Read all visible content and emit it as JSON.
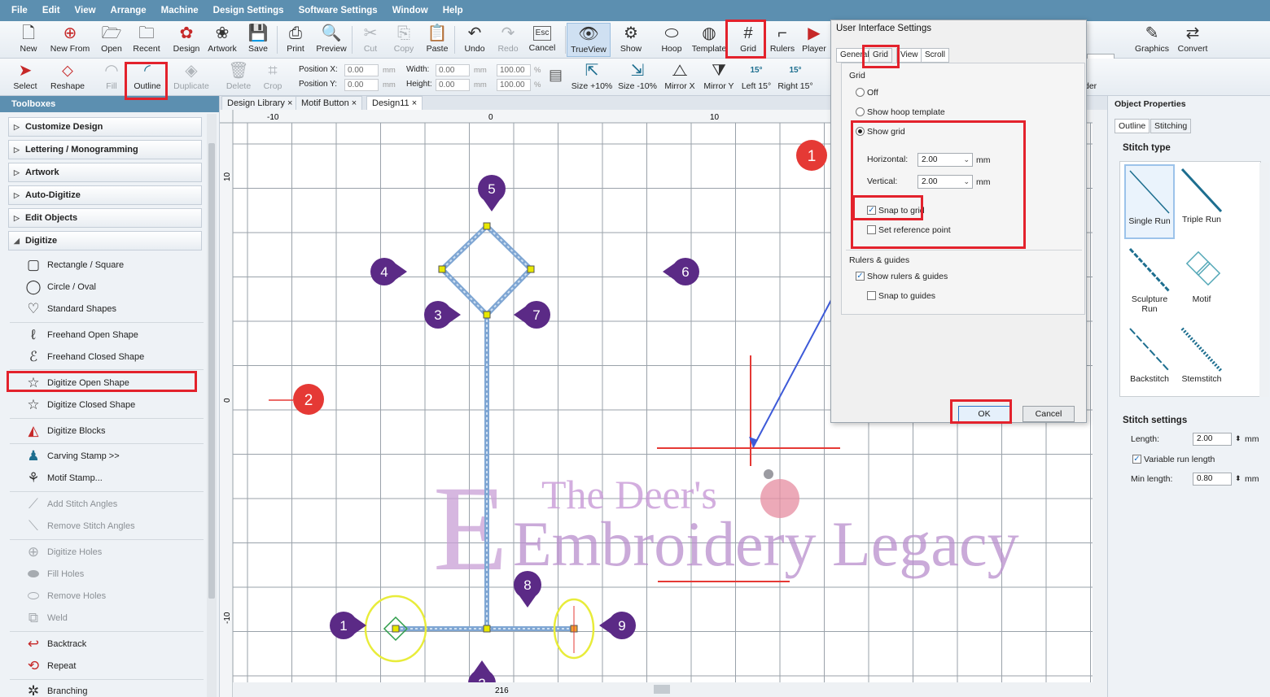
{
  "menu": [
    "File",
    "Edit",
    "View",
    "Arrange",
    "Machine",
    "Design Settings",
    "Software Settings",
    "Window",
    "Help"
  ],
  "toolbar1": [
    {
      "label": "New",
      "icon": "new-file-icon"
    },
    {
      "label": "New From",
      "icon": "new-from-icon"
    },
    {
      "label": "Open",
      "icon": "folder-open-icon"
    },
    {
      "label": "Recent",
      "icon": "recent-folder-icon"
    },
    {
      "label": "Design",
      "icon": "design-icon"
    },
    {
      "label": "Artwork",
      "icon": "artwork-icon"
    },
    {
      "label": "Save",
      "icon": "save-icon"
    },
    {
      "label": "Print",
      "icon": "print-icon"
    },
    {
      "label": "Preview",
      "icon": "preview-icon"
    },
    {
      "label": "Cut",
      "icon": "cut-icon"
    },
    {
      "label": "Copy",
      "icon": "copy-icon"
    },
    {
      "label": "Paste",
      "icon": "paste-icon"
    },
    {
      "label": "Undo",
      "icon": "undo-icon"
    },
    {
      "label": "Redo",
      "icon": "redo-icon"
    },
    {
      "label": "Cancel",
      "icon": "esc-icon",
      "glyph": "Esc"
    },
    {
      "label": "TrueView",
      "icon": "trueview-icon"
    },
    {
      "label": "Show",
      "icon": "show-icon"
    },
    {
      "label": "Hoop",
      "icon": "hoop-icon"
    },
    {
      "label": "Template",
      "icon": "template-icon"
    },
    {
      "label": "Grid",
      "icon": "grid-icon"
    },
    {
      "label": "Rulers",
      "icon": "rulers-icon"
    },
    {
      "label": "Player",
      "icon": "player-icon"
    },
    {
      "label": "Graphics",
      "icon": "graphics-icon"
    },
    {
      "label": "Convert",
      "icon": "convert-icon"
    }
  ],
  "toolbar2": [
    {
      "label": "Select",
      "icon": "select-arrow-icon"
    },
    {
      "label": "Reshape",
      "icon": "reshape-icon"
    },
    {
      "label": "Fill",
      "icon": "fill-icon"
    },
    {
      "label": "Outline",
      "icon": "outline-icon"
    },
    {
      "label": "Duplicate",
      "icon": "duplicate-icon"
    },
    {
      "label": "Delete",
      "icon": "delete-icon"
    },
    {
      "label": "Crop",
      "icon": "crop-icon"
    },
    {
      "label": "Size +10%",
      "icon": "size-plus-icon"
    },
    {
      "label": "Size -10%",
      "icon": "size-minus-icon"
    },
    {
      "label": "Mirror X",
      "icon": "mirror-x-icon"
    },
    {
      "label": "Mirror Y",
      "icon": "mirror-y-icon"
    },
    {
      "label": "Left 15°",
      "icon": "rotate-left-icon"
    },
    {
      "label": "Right 15°",
      "icon": "rotate-right-icon"
    }
  ],
  "position": {
    "pos_x_label": "Position X:",
    "pos_x": "0.00",
    "pos_y_label": "Position Y:",
    "pos_y": "0.00",
    "width_label": "Width:",
    "width": "0.00",
    "height_label": "Height:",
    "height": "0.00",
    "scale_w": "100.00",
    "scale_h": "100.00",
    "unit_mm": "mm",
    "unit_pct": "%",
    "rot15": "15°"
  },
  "toolbox": {
    "title": "Toolboxes",
    "categories": [
      "Customize Design",
      "Lettering / Monogramming",
      "Artwork",
      "Auto-Digitize",
      "Edit Objects",
      "Digitize"
    ],
    "tools": [
      {
        "label": "Rectangle / Square",
        "icon": "rectangle-icon"
      },
      {
        "label": "Circle / Oval",
        "icon": "circle-icon"
      },
      {
        "label": "Standard Shapes",
        "icon": "standard-shapes-icon"
      },
      {
        "label": "Freehand Open Shape",
        "icon": "freehand-open-icon"
      },
      {
        "label": "Freehand Closed Shape",
        "icon": "freehand-closed-icon"
      },
      {
        "label": "Digitize Open Shape",
        "icon": "digitize-open-icon"
      },
      {
        "label": "Digitize Closed Shape",
        "icon": "digitize-closed-icon"
      },
      {
        "label": "Digitize Blocks",
        "icon": "digitize-blocks-icon"
      },
      {
        "label": "Carving Stamp >>",
        "icon": "carving-stamp-icon"
      },
      {
        "label": "Motif Stamp...",
        "icon": "motif-stamp-icon"
      },
      {
        "label": "Add Stitch Angles",
        "icon": "add-angles-icon"
      },
      {
        "label": "Remove Stitch Angles",
        "icon": "remove-angles-icon"
      },
      {
        "label": "Digitize Holes",
        "icon": "digitize-holes-icon"
      },
      {
        "label": "Fill Holes",
        "icon": "fill-holes-icon"
      },
      {
        "label": "Remove Holes",
        "icon": "remove-holes-icon"
      },
      {
        "label": "Weld",
        "icon": "weld-icon"
      },
      {
        "label": "Backtrack",
        "icon": "backtrack-icon"
      },
      {
        "label": "Repeat",
        "icon": "repeat-icon"
      },
      {
        "label": "Branching",
        "icon": "branching-icon"
      }
    ]
  },
  "doc_tabs": [
    "Design Library ×",
    "Motif Button ×",
    "Design11 ×"
  ],
  "ruler": {
    "minus10": "-10",
    "zero": "0",
    "plus10": "10",
    "v10": "10",
    "v0": "0",
    "vminus10": "-10"
  },
  "markers": [
    "1",
    "2",
    "3",
    "4",
    "5",
    "6",
    "7",
    "8",
    "9"
  ],
  "callouts": [
    "1",
    "2"
  ],
  "watermark": {
    "line1": "The Deer's",
    "line2": "Embroidery Legacy"
  },
  "canvas_status": "216",
  "dialog": {
    "title": "User Interface Settings",
    "tabs": [
      "General",
      "Grid",
      "View",
      "Scroll"
    ],
    "grid_group": "Grid",
    "off": "Off",
    "show_hoop_template": "Show hoop template",
    "show_grid": "Show grid",
    "horizontal_label": "Horizontal:",
    "horizontal": "2.00",
    "vertical_label": "Vertical:",
    "vertical": "2.00",
    "unit": "mm",
    "snap_to_grid": "Snap to grid",
    "set_reference_point": "Set reference point",
    "rulers_group": "Rulers & guides",
    "show_rulers": "Show rulers & guides",
    "snap_to_guides": "Snap to guides",
    "ok": "OK",
    "cancel": "Cancel"
  },
  "props": {
    "title": "Object Properties",
    "tabs": [
      "Outline",
      "Stitching"
    ],
    "stitch_type": "Stitch type",
    "types": [
      "Single Run",
      "Triple Run",
      "Sculpture Run",
      "Motif",
      "Backstitch",
      "Stemstitch"
    ],
    "stitch_settings": "Stitch settings",
    "length_label": "Length:",
    "length": "2.00",
    "variable_run": "Variable run length",
    "min_length_label": "Min length:",
    "min_length": "0.80",
    "unit": "mm",
    "partial_label": "der"
  },
  "colors": {
    "accent": "#5c8fb0",
    "highlight": "#e3222c",
    "marker": "#5b2a86",
    "callout": "#e53935",
    "stitch": "#8fb3d9"
  }
}
